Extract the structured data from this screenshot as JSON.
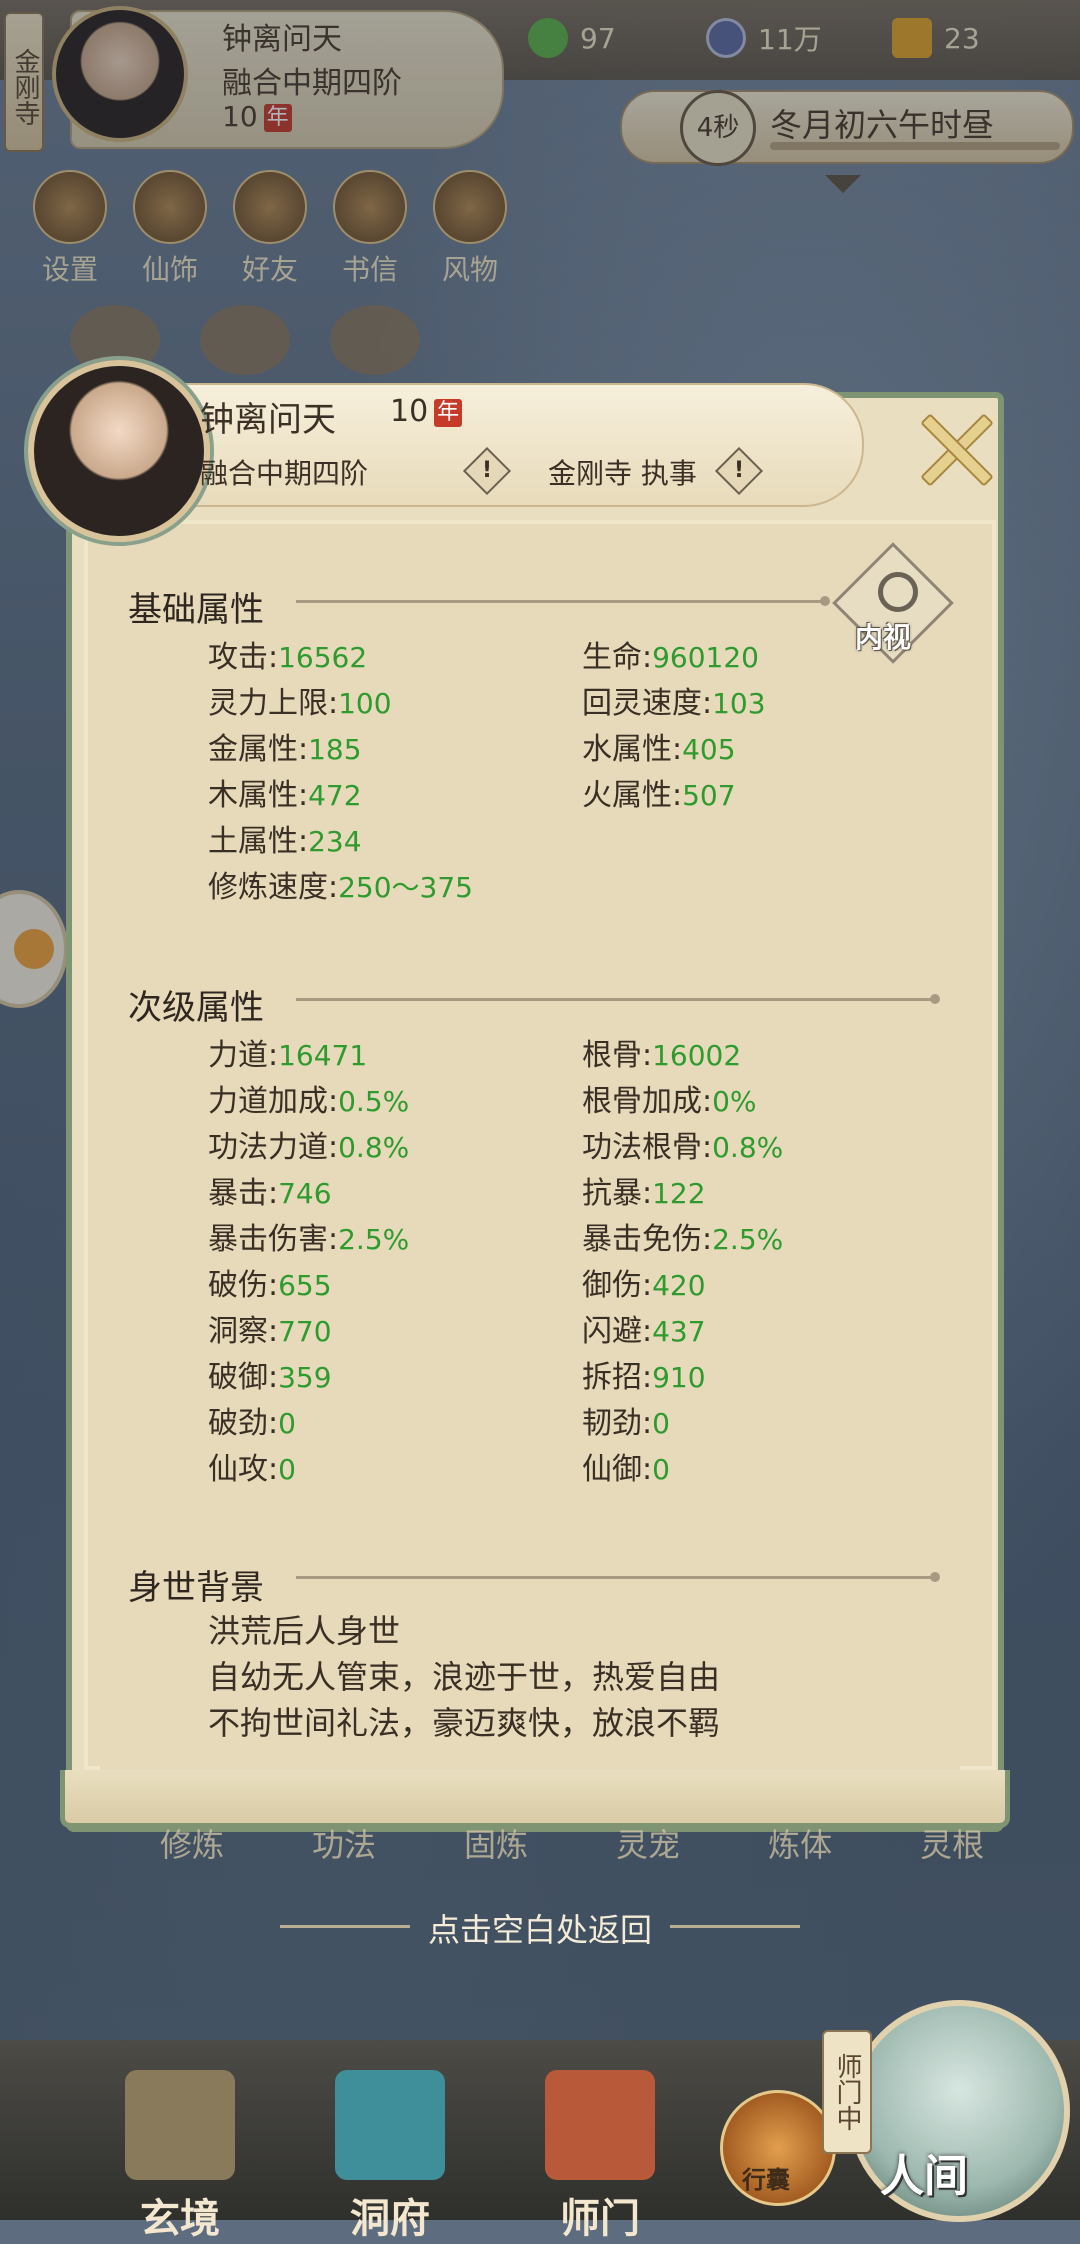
{
  "top": {
    "sect_tag": "金刚寺",
    "player_name": "钟离问天",
    "player_realm": "融合中期四阶",
    "player_age": "10",
    "age_badge": "年",
    "resources": [
      {
        "icon": "jade-icon",
        "value": "97"
      },
      {
        "icon": "coin-icon",
        "value": "11万"
      },
      {
        "icon": "gold-cross-icon",
        "value": "23"
      }
    ],
    "timer": "4秒",
    "time_text": "冬月初六午时昼"
  },
  "menu": [
    "设置",
    "仙饰",
    "好友",
    "书信",
    "风物"
  ],
  "panel": {
    "name": "钟离问天",
    "age": "10",
    "age_badge": "年",
    "realm": "融合中期四阶",
    "sect": "金刚寺 执事",
    "info_mark": "!",
    "inner_view_label": "内视",
    "basic_title": "基础属性",
    "basic": [
      {
        "label": "攻击",
        "value": "16562"
      },
      {
        "label": "生命",
        "value": "960120"
      },
      {
        "label": "灵力上限",
        "value": "100"
      },
      {
        "label": "回灵速度",
        "value": "103"
      },
      {
        "label": "金属性",
        "value": "185"
      },
      {
        "label": "水属性",
        "value": "405"
      },
      {
        "label": "木属性",
        "value": "472"
      },
      {
        "label": "火属性",
        "value": "507"
      },
      {
        "label": "土属性",
        "value": "234"
      },
      {
        "label": "修炼速度",
        "value": "250～375"
      }
    ],
    "secondary_title": "次级属性",
    "secondary": [
      {
        "label": "力道",
        "value": "16471"
      },
      {
        "label": "根骨",
        "value": "16002"
      },
      {
        "label": "力道加成",
        "value": "0.5%"
      },
      {
        "label": "根骨加成",
        "value": "0%"
      },
      {
        "label": "功法力道",
        "value": "0.8%"
      },
      {
        "label": "功法根骨",
        "value": "0.8%"
      },
      {
        "label": "暴击",
        "value": "746"
      },
      {
        "label": "抗暴",
        "value": "122"
      },
      {
        "label": "暴击伤害",
        "value": "2.5%"
      },
      {
        "label": "暴击免伤",
        "value": "2.5%"
      },
      {
        "label": "破伤",
        "value": "655"
      },
      {
        "label": "御伤",
        "value": "420"
      },
      {
        "label": "洞察",
        "value": "770"
      },
      {
        "label": "闪避",
        "value": "437"
      },
      {
        "label": "破御",
        "value": "359"
      },
      {
        "label": "拆招",
        "value": "910"
      },
      {
        "label": "破劲",
        "value": "0"
      },
      {
        "label": "韧劲",
        "value": "0"
      },
      {
        "label": "仙攻",
        "value": "0"
      },
      {
        "label": "仙御",
        "value": "0"
      }
    ],
    "background_title": "身世背景",
    "background_lines": [
      "洪荒后人身世",
      "自幼无人管束，浪迹于世，热爱自由",
      "不拘世间礼法，豪迈爽快，放浪不羁"
    ]
  },
  "behind_tabs": [
    "修炼",
    "功法",
    "固炼",
    "灵宠",
    "炼体",
    "灵根"
  ],
  "return_hint": "点击空白处返回",
  "bottom_nav": {
    "xuanjing": "玄境",
    "dongfu": "洞府",
    "shimen": "师门",
    "bag": "行囊",
    "sect_vert": "师门中",
    "renjian": "人间"
  },
  "colors": {
    "value_green": "#2f9b2f",
    "panel_bg": "#e9dfc0",
    "panel_border": "#7f9473"
  }
}
